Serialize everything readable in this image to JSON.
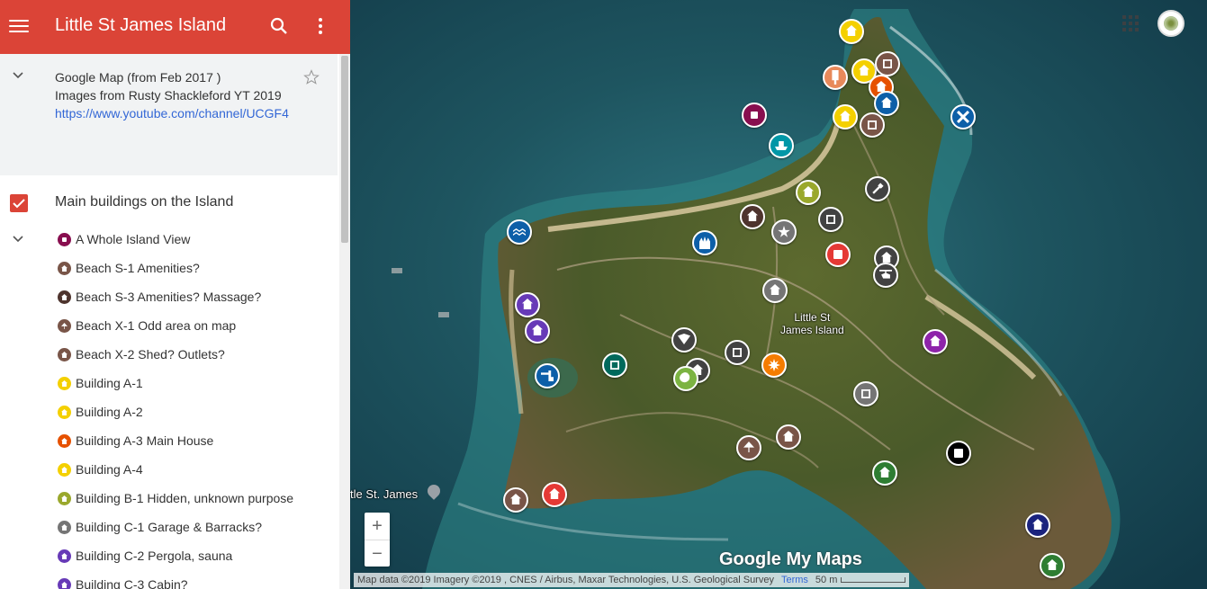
{
  "header": {
    "title": "Little St James Island"
  },
  "description": {
    "line1": "Google Map (from Feb 2017 )",
    "line2": "Images from Rusty Shackleford YT 2019",
    "link": "https://www.youtube.com/channel/UCGF4"
  },
  "layer": {
    "title": "Main buildings on the Island"
  },
  "items": [
    {
      "label": "A Whole Island View",
      "color": "#880e4f"
    },
    {
      "label": "Beach S-1 Amenities?",
      "color": "#795548"
    },
    {
      "label": "Beach S-3 Amenities? Massage?",
      "color": "#4e342e"
    },
    {
      "label": "Beach X-1 Odd area on map",
      "color": "#795548"
    },
    {
      "label": "Beach X-2 Shed? Outlets?",
      "color": "#795548"
    },
    {
      "label": "Building A-1",
      "color": "#f4d000"
    },
    {
      "label": "Building A-2",
      "color": "#f4d000"
    },
    {
      "label": "Building A-3 Main House",
      "color": "#e65100"
    },
    {
      "label": "Building A-4",
      "color": "#f4d000"
    },
    {
      "label": "Building B-1 Hidden, unknown purpose",
      "color": "#9aa82c"
    },
    {
      "label": "Building C-1 Garage & Barracks?",
      "color": "#757575"
    },
    {
      "label": "Building C-2 Pergola, sauna",
      "color": "#673ab7"
    },
    {
      "label": "Building C-3 Cabin?",
      "color": "#673ab7"
    }
  ],
  "map": {
    "place_label_line1": "Little St",
    "place_label_line2": "James Island",
    "side_label": "tle St. James",
    "logo": "Google My Maps",
    "attribution": "Map data ©2019 Imagery ©2019 , CNES / Airbus, Maxar Technologies, U.S. Geological Survey",
    "terms": "Terms",
    "scale": "50 m",
    "zoom_in": "+",
    "zoom_out": "−"
  },
  "colors": {
    "header": "#db4437",
    "link": "#3367d6"
  }
}
